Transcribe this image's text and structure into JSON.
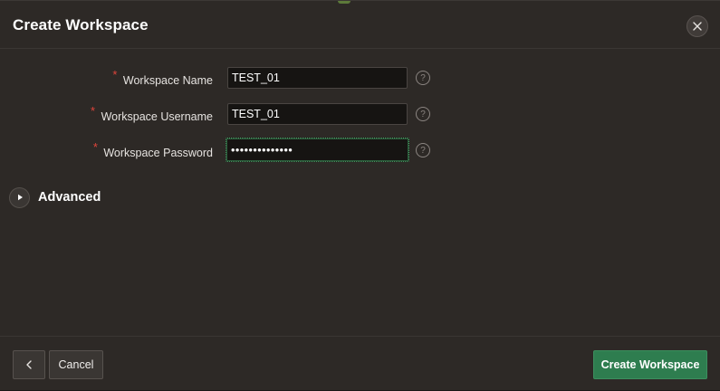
{
  "dialog": {
    "title": "Create Workspace",
    "close_label": "Close"
  },
  "form": {
    "workspace_name": {
      "label": "Workspace Name",
      "required_mark": "*",
      "value": "TEST_01",
      "help": "?"
    },
    "workspace_username": {
      "label": "Workspace Username",
      "required_mark": "*",
      "value": "TEST_01",
      "help": "?"
    },
    "workspace_password": {
      "label": "Workspace Password",
      "required_mark": "*",
      "value": "••••••••••••••",
      "help": "?"
    }
  },
  "advanced": {
    "label": "Advanced",
    "expanded": false
  },
  "footer": {
    "back_icon": "chevron-left-icon",
    "cancel_label": "Cancel",
    "create_label": "Create Workspace"
  },
  "colors": {
    "background": "#2d2926",
    "primary_button": "#2e7d4f",
    "required": "#e0453b",
    "focus_ring": "#4fa36b"
  }
}
